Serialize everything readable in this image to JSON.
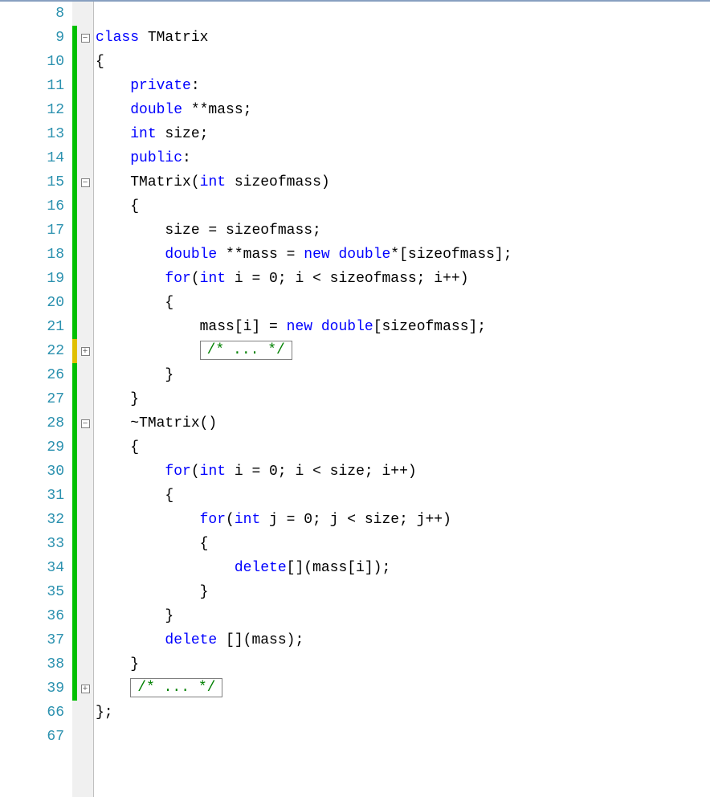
{
  "lineNumbers": [
    "8",
    "9",
    "10",
    "11",
    "12",
    "13",
    "14",
    "15",
    "16",
    "17",
    "18",
    "19",
    "20",
    "21",
    "22",
    "26",
    "27",
    "28",
    "29",
    "30",
    "31",
    "32",
    "33",
    "34",
    "35",
    "36",
    "37",
    "38",
    "39",
    "66",
    "67"
  ],
  "changeBars": [
    "",
    "green",
    "green",
    "green",
    "green",
    "green",
    "green",
    "green",
    "green",
    "green",
    "green",
    "green",
    "green",
    "green",
    "yellow",
    "green",
    "green",
    "green",
    "green",
    "green",
    "green",
    "green",
    "green",
    "green",
    "green",
    "green",
    "green",
    "green",
    "green",
    "",
    ""
  ],
  "foldMarkers": [
    "",
    "minus",
    "",
    "",
    "",
    "",
    "",
    "minus",
    "",
    "",
    "",
    "",
    "",
    "",
    "plus",
    "",
    "",
    "minus",
    "",
    "",
    "",
    "",
    "",
    "",
    "",
    "",
    "",
    "",
    "plus",
    "",
    ""
  ],
  "foldedComment": "/* ... */",
  "code": {
    "l8": "",
    "l9_kw": "class",
    "l9_txt": " TMatrix",
    "l10": "{",
    "l11_ind": "    ",
    "l11_kw": "private",
    "l11_txt": ":",
    "l12_ind": "    ",
    "l12_kw": "double",
    "l12_txt": " **mass;",
    "l13_ind": "    ",
    "l13_kw": "int",
    "l13_txt": " size;",
    "l14_ind": "    ",
    "l14_kw": "public",
    "l14_txt": ":",
    "l15_ind": "    ",
    "l15_txt1": "TMatrix(",
    "l15_kw": "int",
    "l15_txt2": " sizeofmass)",
    "l16": "    {",
    "l17_ind": "        ",
    "l17_txt": "size = sizeofmass;",
    "l18_ind": "        ",
    "l18_kw1": "double",
    "l18_txt1": " **mass = ",
    "l18_kw2": "new",
    "l18_txt2": " ",
    "l18_kw3": "double",
    "l18_txt3": "*[sizeofmass];",
    "l19_ind": "        ",
    "l19_kw1": "for",
    "l19_txt1": "(",
    "l19_kw2": "int",
    "l19_txt2": " i = 0; i < sizeofmass; i++)",
    "l20": "        {",
    "l21_ind": "            ",
    "l21_txt1": "mass[i] = ",
    "l21_kw1": "new",
    "l21_txt2": " ",
    "l21_kw2": "double",
    "l21_txt3": "[sizeofmass];",
    "l22_ind": "            ",
    "l26": "        }",
    "l27": "    }",
    "l28_ind": "    ",
    "l28_txt": "~TMatrix()",
    "l29": "    {",
    "l30_ind": "        ",
    "l30_kw1": "for",
    "l30_txt1": "(",
    "l30_kw2": "int",
    "l30_txt2": " i = 0; i < size; i++)",
    "l31": "        {",
    "l32_ind": "            ",
    "l32_kw1": "for",
    "l32_txt1": "(",
    "l32_kw2": "int",
    "l32_txt2": " j = 0; j < size; j++)",
    "l33": "            {",
    "l34_ind": "                ",
    "l34_kw": "delete",
    "l34_txt": "[](mass[i]);",
    "l35": "            }",
    "l36": "        }",
    "l37_ind": "        ",
    "l37_kw": "delete",
    "l37_txt": " [](mass);",
    "l38": "    }",
    "l39_ind": "    ",
    "l66": "};",
    "l67": ""
  }
}
